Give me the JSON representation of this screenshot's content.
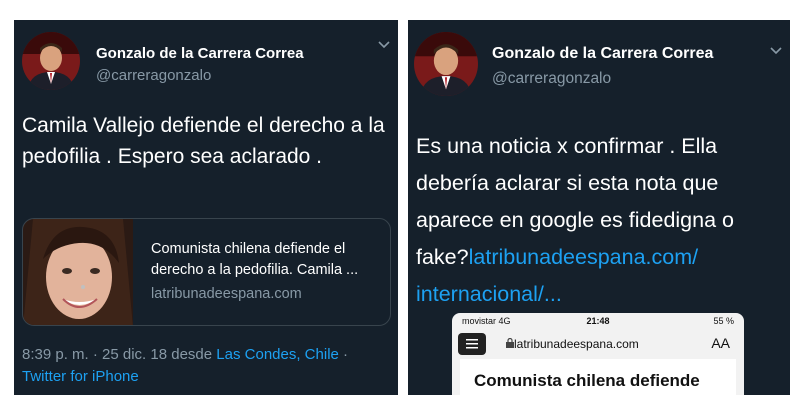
{
  "left": {
    "author_name": "Gonzalo de la Carrera Correa",
    "author_handle": "@carreragonzalo",
    "tweet_text": "Camila Vallejo defiende el derecho a la pedofilia . Espero sea aclarado .",
    "card": {
      "title": "Comunista chilena defiende el derecho a la pedofilia. Camila ...",
      "domain": "latribunadeespana.com"
    },
    "meta": {
      "time": "8:39 p. m. · 25 dic. 18 desde ",
      "location": "Las Condes, Chile",
      "sep": " · ",
      "client": "Twitter for iPhone"
    }
  },
  "right": {
    "author_name": "Gonzalo de la Carrera Correa",
    "author_handle": "@carreragonzalo",
    "tweet_text": "Es una noticia x confirmar . Ella debería aclarar si esta nota que aparece en google es fidedigna o fake?",
    "tweet_link": "latribunadeespana.com/ internacional/...",
    "phone": {
      "carrier": "movistar  4G",
      "time": "21:48",
      "battery": "55 %",
      "url": "latribunadeespana.com",
      "text_size": "AA",
      "article_title": "Comunista chilena defiende"
    }
  },
  "colors": {
    "panel_bg": "#15202b",
    "link": "#1da1f2",
    "secondary_text": "#8899a6"
  }
}
